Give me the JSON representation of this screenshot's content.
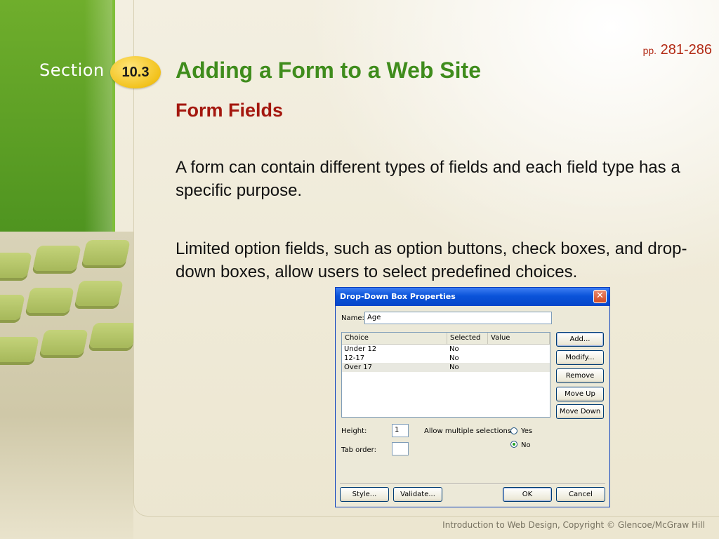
{
  "slide": {
    "section_label": "Section",
    "section_number": "10.3",
    "pages_prefix": "pp.",
    "pages_range": "281-286",
    "title": "Adding a Form to a Web Site",
    "subtitle": "Form Fields",
    "paragraphs": [
      "A form can contain different types of fields and each field type has a specific purpose.",
      "Limited option fields, such as option buttons, check boxes, and drop-down boxes, allow users to select predefined choices."
    ],
    "footer": "Introduction to Web Design, Copyright © Glencoe/McGraw Hill"
  },
  "dialog": {
    "title": "Drop-Down Box Properties",
    "close_glyph": "✕",
    "name_label": "Name:",
    "name_value": "Age",
    "columns": [
      "Choice",
      "Selected",
      "Value"
    ],
    "rows": [
      {
        "choice": "Under 12",
        "selected": "No",
        "value": ""
      },
      {
        "choice": "12-17",
        "selected": "No",
        "value": ""
      },
      {
        "choice": "Over 17",
        "selected": "No",
        "value": ""
      }
    ],
    "side_buttons": {
      "add": "Add...",
      "modify": "Modify...",
      "remove": "Remove",
      "move_up": "Move Up",
      "move_down": "Move Down"
    },
    "height_label": "Height:",
    "height_value": "1",
    "allow_multiple_label": "Allow multiple selections:",
    "yes_label": "Yes",
    "no_label": "No",
    "allow_multiple_selected": "No",
    "tab_order_label": "Tab order:",
    "tab_order_value": "",
    "bottom_buttons": {
      "style": "Style...",
      "validate": "Validate...",
      "ok": "OK",
      "cancel": "Cancel"
    }
  },
  "colors": {
    "title_green": "#3f8c1c",
    "subtitle_red": "#a4170e",
    "badge_yellow": "#f2c21c",
    "dialog_titlebar_blue": "#0a53d9"
  },
  "icons": [
    "close-icon",
    "radio-yes",
    "radio-no"
  ]
}
